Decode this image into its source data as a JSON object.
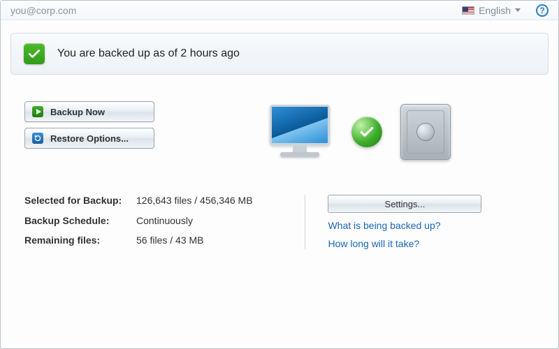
{
  "header": {
    "email": "you@corp.com",
    "language": "English"
  },
  "status": {
    "message": "You are backed up as of 2 hours ago"
  },
  "actions": {
    "backup_now": "Backup Now",
    "restore_options": "Restore Options..."
  },
  "stats": {
    "selected_label": "Selected for Backup:",
    "selected_value": "126,643 files / 456,346 MB",
    "schedule_label": "Backup Schedule:",
    "schedule_value": "Continuously",
    "remaining_label": "Remaining files:",
    "remaining_value": "56 files / 43 MB"
  },
  "right": {
    "settings": "Settings...",
    "link_what": "What is being backed up?",
    "link_howlong": "How long will it take?"
  }
}
